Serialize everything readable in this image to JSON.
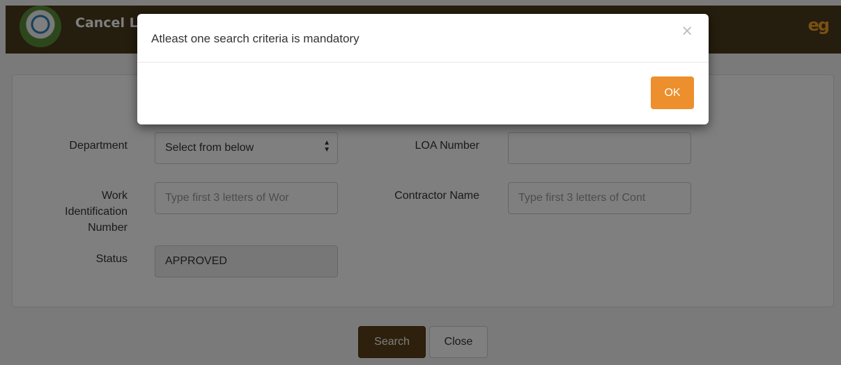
{
  "header": {
    "title": "Cancel LOA",
    "logo_text": "eg"
  },
  "form": {
    "department": {
      "label": "Department",
      "value": "Select from below"
    },
    "loa_number": {
      "label": "LOA Number",
      "value": ""
    },
    "work_id": {
      "label_line1": "Work",
      "label_line2": "Identification",
      "label_line3": "Number",
      "placeholder": "Type first 3 letters of Wor"
    },
    "contractor": {
      "label": "Contractor Name",
      "placeholder": "Type first 3 letters of Cont"
    },
    "status": {
      "label": "Status",
      "value": "APPROVED"
    }
  },
  "actions": {
    "search_label": "Search",
    "close_label": "Close"
  },
  "modal": {
    "message": "Atleast one search criteria is mandatory",
    "close_glyph": "×",
    "ok_label": "OK"
  },
  "colors": {
    "header_bg": "#4b3a1a",
    "search_btn": "#5a4118",
    "ok_btn": "#ec8f2c",
    "logo": "#f3a028"
  }
}
